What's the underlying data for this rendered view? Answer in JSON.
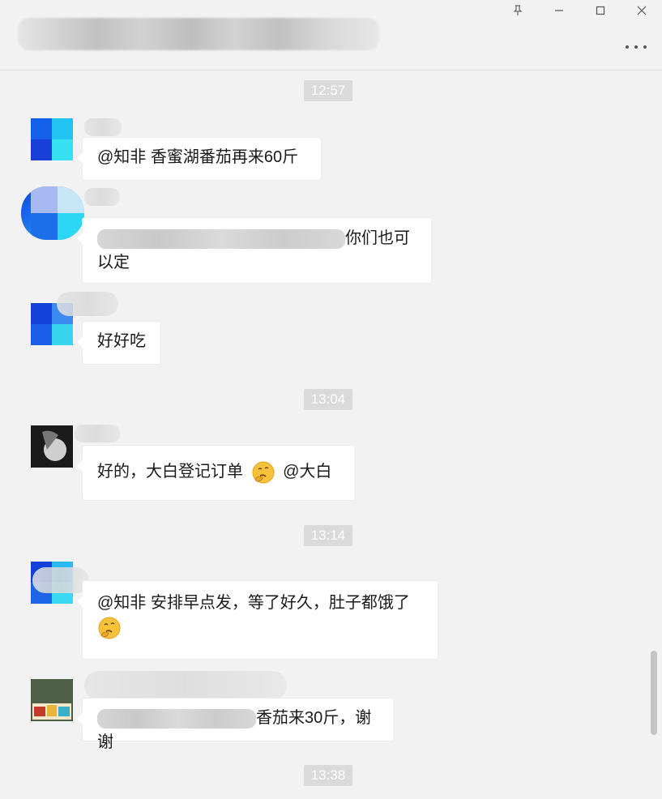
{
  "window": {
    "pin_icon": "pin-icon",
    "minimize_icon": "minimize-icon",
    "maximize_icon": "maximize-icon",
    "close_icon": "close-icon",
    "more_icon": "more-icon"
  },
  "timestamps": [
    "12:57",
    "13:04",
    "13:14",
    "13:38"
  ],
  "messages": [
    {
      "text": "@知非 香蜜湖番茄再来60斤"
    },
    {
      "text": "你们也可\n以定"
    },
    {
      "text": "好好吃"
    },
    {
      "text": "好的，大白登记订单",
      "text_after": "@大白",
      "emoji": "thinking-face"
    },
    {
      "text": "@知非 安排早点发，等了好久，肚子都饿了",
      "emoji": "thinking-face"
    },
    {
      "text": "香茄来30斤，谢谢"
    }
  ],
  "colors": {
    "background": "#f2f2f2",
    "bubble": "#ffffff",
    "timestamp_bg": "#dadada",
    "timestamp_text": "#ffffff"
  }
}
